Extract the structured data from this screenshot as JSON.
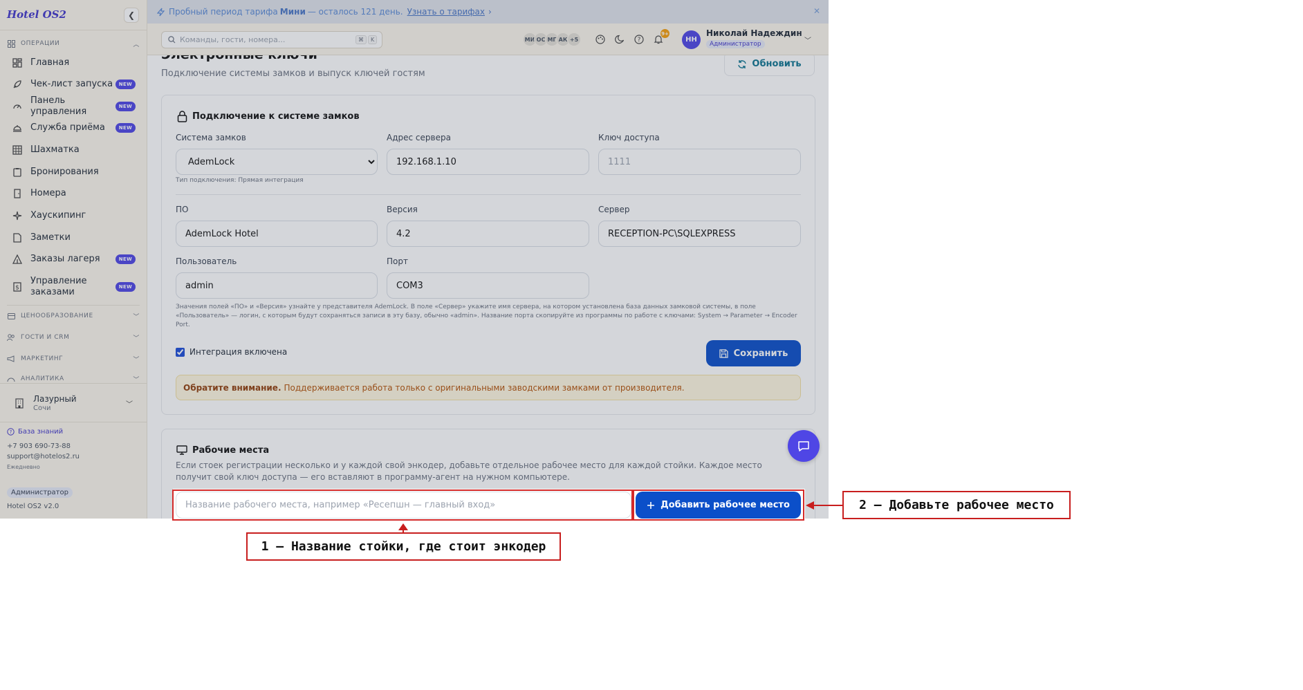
{
  "sidebar": {
    "brand": "Hotel OS2",
    "collapse_icon": "chevron-left-icon",
    "sections": [
      {
        "label": "ОПЕРАЦИИ",
        "expanded": true
      },
      {
        "label": "ЦЕНООБРАЗОВАНИЕ",
        "expanded": false
      },
      {
        "label": "ГОСТИ И CRM",
        "expanded": false
      },
      {
        "label": "МАРКЕТИНГ",
        "expanded": false
      },
      {
        "label": "АНАЛИТИКА",
        "expanded": false
      }
    ],
    "items": [
      {
        "label": "Главная",
        "icon": "dashboard-icon",
        "badge": ""
      },
      {
        "label": "Чек-лист запуска",
        "icon": "rocket-icon",
        "badge": "NEW"
      },
      {
        "label": "Панель управления",
        "icon": "gauge-icon",
        "badge": "NEW"
      },
      {
        "label": "Служба приёма",
        "icon": "bell-desk-icon",
        "badge": "NEW"
      },
      {
        "label": "Шахматка",
        "icon": "grid-icon",
        "badge": ""
      },
      {
        "label": "Бронирования",
        "icon": "clipboard-icon",
        "badge": ""
      },
      {
        "label": "Номера",
        "icon": "door-icon",
        "badge": ""
      },
      {
        "label": "Хаускипинг",
        "icon": "sparkle-icon",
        "badge": ""
      },
      {
        "label": "Заметки",
        "icon": "note-icon",
        "badge": ""
      },
      {
        "label": "Заказы лагеря",
        "icon": "tent-icon",
        "badge": "NEW"
      },
      {
        "label": "Управление заказами",
        "icon": "receipt-icon",
        "badge": "NEW"
      }
    ],
    "hotel": {
      "name": "Лазурный",
      "city": "Сочи"
    },
    "footer": {
      "knowledge_base": "База знаний",
      "phone": "+7 903 690-73-88",
      "email": "support@hotelos2.ru",
      "hours": "Ежедневно",
      "role": "Администратор",
      "version": "Hotel OS2 v2.0"
    }
  },
  "banner": {
    "prefix": "Пробный период тарифа",
    "plan": "Мини",
    "suffix": "— осталось 121 день.",
    "link": "Узнать о тарифах",
    "link_arrow": "›",
    "close": "✕"
  },
  "topbar": {
    "search_placeholder": "Команды, гости, номера...",
    "shortcut_keys": [
      "⌘",
      "K"
    ],
    "avatars": [
      "МИ",
      "ОС",
      "МГ",
      "АК"
    ],
    "avatars_more": "+5",
    "notifications_count": "9+",
    "user": {
      "initials": "НН",
      "name": "Николай Надеждин",
      "role": "Администратор"
    }
  },
  "page": {
    "title": "Электронные ключи",
    "subtitle": "Подключение системы замков и выпуск ключей гостям",
    "refresh_label": "Обновить"
  },
  "lock_card": {
    "title": "Подключение к системе замков",
    "lock_system_label": "Система замков",
    "lock_system_value": "AdemLock",
    "connection_type": "Тип подключения: Прямая интеграция",
    "server_address_label": "Адрес сервера",
    "server_address_value": "192.168.1.10",
    "access_key_label": "Ключ доступа",
    "access_key_placeholder": "1111",
    "software_label": "ПО",
    "software_value": "AdemLock Hotel",
    "version_label": "Версия",
    "version_value": "4.2",
    "server_label": "Сервер",
    "server_value": "RECEPTION-PC\\SQLEXPRESS",
    "user_label": "Пользователь",
    "user_value": "admin",
    "port_label": "Порт",
    "port_value": "COM3",
    "help_text": "Значения полей «ПО» и «Версия» узнайте у представителя AdemLock. В поле «Сервер» укажите имя сервера, на котором установлена база данных замковой системы, в поле «Пользователь» — логин, с которым будут сохраняться записи в эту базу, обычно «admin». Название порта скопируйте из программы по работе с ключами: System → Parameter → Encoder Port.",
    "integration_enabled_label": "Интеграция включена",
    "integration_enabled": true,
    "save_label": "Сохранить",
    "warning_bold": "Обратите внимание.",
    "warning_text": "Поддерживается работа только с оригинальными заводскими замками от производителя."
  },
  "workstations_card": {
    "title": "Рабочие места",
    "description": "Если стоек регистрации несколько и у каждой свой энкодер, добавьте отдельное рабочее место для каждой стойки. Каждое место получит свой ключ доступа — его вставляют в программу-агент на нужном компьютере.",
    "name_placeholder": "Название рабочего места, например «Ресепшн — главный вход»",
    "add_label": "Добавить рабочее место"
  },
  "annotations": {
    "callout_1": "1 — Название стойки, где стоит энкодер",
    "callout_2": "2 — Добавьте рабочее место"
  },
  "colors": {
    "accent": "#0b4fc9",
    "brand": "#4338ca",
    "badge": "#4f46e5",
    "annotation": "#c81e1e",
    "sidebar_bg": "#fbf6ec"
  }
}
